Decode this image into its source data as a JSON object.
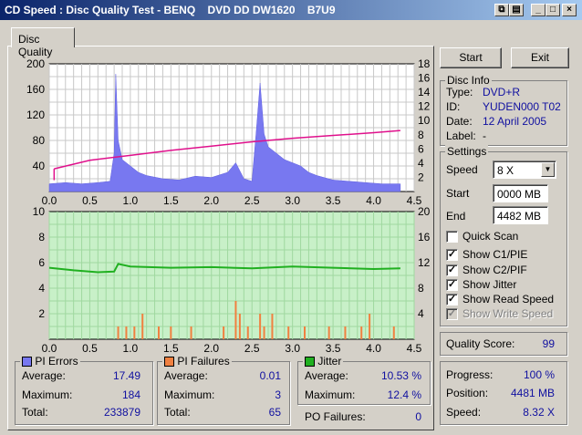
{
  "window": {
    "title": "CD Speed : Disc Quality Test - BENQ    DVD DD DW1620    B7U9"
  },
  "tab": {
    "label": "Disc Quality"
  },
  "buttons": {
    "start": "Start",
    "exit": "Exit"
  },
  "disc_info": {
    "title": "Disc Info",
    "type_label": "Type:",
    "type_value": "DVD+R",
    "id_label": "ID:",
    "id_value": "YUDEN000 T02",
    "date_label": "Date:",
    "date_value": "12 April 2005",
    "label_label": "Label:",
    "label_value": "-"
  },
  "settings": {
    "title": "Settings",
    "speed_label": "Speed",
    "speed_value": "8 X",
    "start_label": "Start",
    "start_value": "0000 MB",
    "end_label": "End",
    "end_value": "4482 MB",
    "quick_scan": {
      "label": "Quick Scan",
      "checked": false
    },
    "show_c1": {
      "label": "Show C1/PIE",
      "checked": true
    },
    "show_c2": {
      "label": "Show C2/PIF",
      "checked": true
    },
    "show_jitter": {
      "label": "Show Jitter",
      "checked": true
    },
    "show_read": {
      "label": "Show Read Speed",
      "checked": true
    },
    "show_write": {
      "label": "Show Write Speed",
      "checked": true
    }
  },
  "quality": {
    "label": "Quality Score:",
    "value": "99"
  },
  "progress": {
    "progress_label": "Progress:",
    "progress_value": "100 %",
    "position_label": "Position:",
    "position_value": "4481 MB",
    "speed_label": "Speed:",
    "speed_value": "8.32 X"
  },
  "pi_errors": {
    "title": "PI Errors",
    "average_label": "Average:",
    "average": "17.49",
    "maximum_label": "Maximum:",
    "maximum": "184",
    "total_label": "Total:",
    "total": "233879",
    "color": "#7878f0"
  },
  "pi_failures": {
    "title": "PI Failures",
    "average_label": "Average:",
    "average": "0.01",
    "maximum_label": "Maximum:",
    "maximum": "3",
    "total_label": "Total:",
    "total": "65",
    "color": "#f08040"
  },
  "jitter": {
    "title": "Jitter",
    "average_label": "Average:",
    "average": "10.53 %",
    "maximum_label": "Maximum:",
    "maximum": "12.4 %",
    "color": "#20b020"
  },
  "po_failures": {
    "label": "PO Failures:",
    "value": "0"
  },
  "chart_data": [
    {
      "type": "area",
      "name": "PI Errors / Read Speed",
      "xlim": [
        0,
        4.5
      ],
      "ylim_left": [
        0,
        200
      ],
      "ylim_right": [
        0,
        18
      ],
      "x_ticks": [
        "0.0",
        "0.5",
        "1.0",
        "1.5",
        "2.0",
        "2.5",
        "3.0",
        "3.5",
        "4.0",
        "4.5"
      ],
      "y_ticks_left": [
        "200",
        "160",
        "120",
        "80",
        "40"
      ],
      "y_ticks_right": [
        "18",
        "16",
        "14",
        "12",
        "10",
        "8",
        "6",
        "4",
        "2"
      ],
      "pie_points": [
        [
          0,
          12
        ],
        [
          0.2,
          14
        ],
        [
          0.4,
          12
        ],
        [
          0.6,
          14
        ],
        [
          0.75,
          16
        ],
        [
          0.8,
          60
        ],
        [
          0.82,
          184
        ],
        [
          0.85,
          80
        ],
        [
          0.9,
          50
        ],
        [
          1.0,
          40
        ],
        [
          1.1,
          30
        ],
        [
          1.2,
          25
        ],
        [
          1.4,
          20
        ],
        [
          1.6,
          18
        ],
        [
          1.8,
          24
        ],
        [
          2.0,
          22
        ],
        [
          2.2,
          30
        ],
        [
          2.3,
          45
        ],
        [
          2.4,
          20
        ],
        [
          2.5,
          16
        ],
        [
          2.55,
          90
        ],
        [
          2.6,
          170
        ],
        [
          2.65,
          90
        ],
        [
          2.7,
          70
        ],
        [
          2.8,
          60
        ],
        [
          2.9,
          50
        ],
        [
          3.0,
          45
        ],
        [
          3.1,
          40
        ],
        [
          3.2,
          30
        ],
        [
          3.3,
          25
        ],
        [
          3.5,
          18
        ],
        [
          3.7,
          16
        ],
        [
          3.9,
          14
        ],
        [
          4.1,
          12
        ],
        [
          4.33,
          12
        ]
      ],
      "read_speed": [
        [
          0.06,
          3.2
        ],
        [
          0.5,
          4.4
        ],
        [
          1.0,
          5.1
        ],
        [
          1.5,
          5.8
        ],
        [
          2.0,
          6.4
        ],
        [
          2.5,
          7.0
        ],
        [
          3.0,
          7.5
        ],
        [
          3.5,
          7.9
        ],
        [
          4.0,
          8.3
        ],
        [
          4.33,
          8.6
        ]
      ]
    },
    {
      "type": "area",
      "name": "PI Failures / Jitter",
      "xlim": [
        0,
        4.5
      ],
      "ylim_left": [
        0,
        10
      ],
      "ylim_right": [
        0,
        20
      ],
      "x_ticks": [
        "0.0",
        "0.5",
        "1.0",
        "1.5",
        "2.0",
        "2.5",
        "3.0",
        "3.5",
        "4.0",
        "4.5"
      ],
      "y_ticks_left": [
        "10",
        "8",
        "6",
        "4",
        "2"
      ],
      "y_ticks_right": [
        "20",
        "16",
        "12",
        "8",
        "4"
      ],
      "pif_bars": [
        [
          0.85,
          1
        ],
        [
          0.95,
          1
        ],
        [
          1.05,
          1
        ],
        [
          1.15,
          2
        ],
        [
          1.35,
          1
        ],
        [
          1.5,
          1
        ],
        [
          1.75,
          1
        ],
        [
          2.15,
          1
        ],
        [
          2.3,
          3
        ],
        [
          2.35,
          2
        ],
        [
          2.45,
          1
        ],
        [
          2.6,
          2
        ],
        [
          2.65,
          1
        ],
        [
          2.75,
          2
        ],
        [
          2.95,
          1
        ],
        [
          3.15,
          1
        ],
        [
          3.45,
          1
        ],
        [
          3.65,
          1
        ],
        [
          3.85,
          1
        ],
        [
          3.95,
          2
        ],
        [
          4.25,
          1
        ]
      ],
      "jitter": [
        [
          0,
          11.2
        ],
        [
          0.3,
          10.8
        ],
        [
          0.6,
          10.5
        ],
        [
          0.8,
          10.6
        ],
        [
          0.85,
          11.8
        ],
        [
          1.0,
          11.4
        ],
        [
          1.5,
          11.2
        ],
        [
          2.0,
          11.3
        ],
        [
          2.5,
          11.1
        ],
        [
          3.0,
          11.4
        ],
        [
          3.5,
          11.2
        ],
        [
          4.0,
          11.0
        ],
        [
          4.33,
          11.1
        ]
      ]
    }
  ]
}
